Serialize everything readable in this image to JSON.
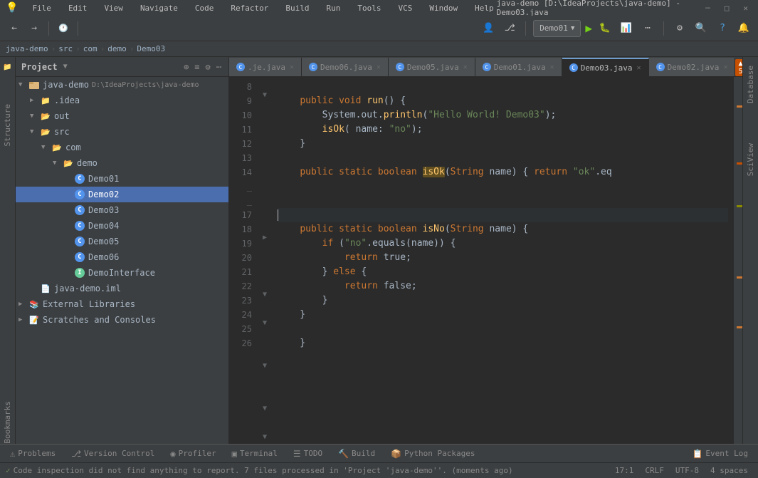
{
  "titlebar": {
    "menu_items": [
      "File",
      "Edit",
      "View",
      "Navigate",
      "Code",
      "Refactor",
      "Build",
      "Run",
      "Tools",
      "VCS",
      "Window",
      "Help"
    ],
    "title": "java-demo [D:\\IdeaProjects\\java-demo] - Demo03.java",
    "win_buttons": [
      "─",
      "□",
      "✕"
    ]
  },
  "toolbar": {
    "run_config": "Demo01",
    "run_label": "▶",
    "debug_label": "🐛"
  },
  "breadcrumb": {
    "items": [
      "java-demo",
      "src",
      "com",
      "demo",
      "Demo03"
    ]
  },
  "project": {
    "title": "Project",
    "root": "java-demo",
    "path": "D:\\IdeaProjects\\java-demo",
    "tree": [
      {
        "label": "java-demo",
        "type": "root",
        "indent": 4,
        "expanded": true,
        "arrow": "▼"
      },
      {
        "label": ".idea",
        "type": "folder",
        "indent": 20,
        "expanded": false,
        "arrow": "▶"
      },
      {
        "label": "out",
        "type": "folder",
        "indent": 20,
        "expanded": true,
        "arrow": "▼"
      },
      {
        "label": "src",
        "type": "folder",
        "indent": 20,
        "expanded": true,
        "arrow": "▼"
      },
      {
        "label": "com",
        "type": "folder",
        "indent": 36,
        "expanded": true,
        "arrow": "▼"
      },
      {
        "label": "demo",
        "type": "folder",
        "indent": 52,
        "expanded": true,
        "arrow": "▼"
      },
      {
        "label": "Demo01",
        "type": "java",
        "indent": 68
      },
      {
        "label": "Demo02",
        "type": "java",
        "indent": 68,
        "selected": true
      },
      {
        "label": "Demo03",
        "type": "java",
        "indent": 68
      },
      {
        "label": "Demo04",
        "type": "java",
        "indent": 68
      },
      {
        "label": "Demo05",
        "type": "java",
        "indent": 68
      },
      {
        "label": "Demo06",
        "type": "java",
        "indent": 68
      },
      {
        "label": "DemoInterface",
        "type": "java-int",
        "indent": 68
      },
      {
        "label": "java-demo.iml",
        "type": "module",
        "indent": 20
      },
      {
        "label": "External Libraries",
        "type": "library",
        "indent": 4,
        "arrow": "▶"
      },
      {
        "label": "Scratches and Consoles",
        "type": "library",
        "indent": 4,
        "arrow": "▶"
      }
    ]
  },
  "tabs": [
    {
      "label": ".je.java",
      "type": "java",
      "active": false
    },
    {
      "label": "Demo06.java",
      "type": "java",
      "active": false
    },
    {
      "label": "Demo05.java",
      "type": "java",
      "active": false
    },
    {
      "label": "Demo01.java",
      "type": "java",
      "active": false
    },
    {
      "label": "Demo03.java",
      "type": "java",
      "active": true
    },
    {
      "label": "Demo02.java",
      "type": "java",
      "active": false
    }
  ],
  "editor": {
    "lines": [
      {
        "num": 8,
        "content": ""
      },
      {
        "num": 9,
        "content": "    public void run() {",
        "tokens": [
          {
            "text": "    ",
            "cls": ""
          },
          {
            "text": "public",
            "cls": "kw"
          },
          {
            "text": " ",
            "cls": ""
          },
          {
            "text": "void",
            "cls": "kw"
          },
          {
            "text": " ",
            "cls": ""
          },
          {
            "text": "run",
            "cls": "fn"
          },
          {
            "text": "() {",
            "cls": ""
          }
        ]
      },
      {
        "num": 10,
        "content": "        System.out.println(\"Hello World! Demo03\");",
        "tokens": [
          {
            "text": "        System.out.",
            "cls": ""
          },
          {
            "text": "println",
            "cls": "fn"
          },
          {
            "text": "(",
            "cls": ""
          },
          {
            "text": "\"Hello World! Demo03\"",
            "cls": "str"
          },
          {
            "text": ");",
            "cls": ""
          }
        ]
      },
      {
        "num": 11,
        "content": "        isOk( name: \"no\");",
        "tokens": [
          {
            "text": "        ",
            "cls": ""
          },
          {
            "text": "isOk",
            "cls": "fn"
          },
          {
            "text": "( ",
            "cls": ""
          },
          {
            "text": "name",
            "cls": "param"
          },
          {
            "text": ": ",
            "cls": ""
          },
          {
            "text": "\"no\"",
            "cls": "str"
          },
          {
            "text": ");",
            "cls": ""
          }
        ]
      },
      {
        "num": 12,
        "content": "    }",
        "tokens": [
          {
            "text": "    }",
            "cls": ""
          }
        ]
      },
      {
        "num": 13,
        "content": ""
      },
      {
        "num": 14,
        "content": "    public static boolean isOk(String name) { return \"ok\".eq",
        "tokens": [
          {
            "text": "    ",
            "cls": ""
          },
          {
            "text": "public",
            "cls": "kw"
          },
          {
            "text": " ",
            "cls": ""
          },
          {
            "text": "static",
            "cls": "kw"
          },
          {
            "text": " ",
            "cls": ""
          },
          {
            "text": "boolean",
            "cls": "kw"
          },
          {
            "text": " ",
            "cls": ""
          },
          {
            "text": "isOk",
            "cls": "fn highlight-isok"
          },
          {
            "text": "(",
            "cls": ""
          },
          {
            "text": "String",
            "cls": "type"
          },
          {
            "text": " ",
            "cls": ""
          },
          {
            "text": "name",
            "cls": "param"
          },
          {
            "text": ") { ",
            "cls": ""
          },
          {
            "text": "return",
            "cls": "kw"
          },
          {
            "text": " ",
            "cls": ""
          },
          {
            "text": "\"ok\"",
            "cls": "str"
          },
          {
            "text": ".eq",
            "cls": ""
          }
        ]
      },
      {
        "num": 17,
        "content": "",
        "cursor": true
      },
      {
        "num": 18,
        "content": "    public static boolean isNo(String name) {",
        "tokens": [
          {
            "text": "    ",
            "cls": ""
          },
          {
            "text": "public",
            "cls": "kw"
          },
          {
            "text": " ",
            "cls": ""
          },
          {
            "text": "static",
            "cls": "kw"
          },
          {
            "text": " ",
            "cls": ""
          },
          {
            "text": "boolean",
            "cls": "kw"
          },
          {
            "text": " ",
            "cls": ""
          },
          {
            "text": "isNo",
            "cls": "fn"
          },
          {
            "text": "(",
            "cls": ""
          },
          {
            "text": "String",
            "cls": "type"
          },
          {
            "text": " ",
            "cls": ""
          },
          {
            "text": "name",
            "cls": "param"
          },
          {
            "text": ") {",
            "cls": ""
          }
        ]
      },
      {
        "num": 19,
        "content": "        if (\"no\".equals(name)) {",
        "tokens": [
          {
            "text": "        ",
            "cls": ""
          },
          {
            "text": "if",
            "cls": "kw"
          },
          {
            "text": " (",
            "cls": ""
          },
          {
            "text": "\"no\"",
            "cls": "str"
          },
          {
            "text": ".equals(name)) {",
            "cls": ""
          }
        ]
      },
      {
        "num": 20,
        "content": "            return true;",
        "tokens": [
          {
            "text": "            ",
            "cls": ""
          },
          {
            "text": "return",
            "cls": "kw"
          },
          {
            "text": " true;",
            "cls": ""
          }
        ]
      },
      {
        "num": 21,
        "content": "        } else {",
        "tokens": [
          {
            "text": "        } ",
            "cls": ""
          },
          {
            "text": "else",
            "cls": "kw"
          },
          {
            "text": " {",
            "cls": ""
          }
        ]
      },
      {
        "num": 22,
        "content": "            return false;",
        "tokens": [
          {
            "text": "            ",
            "cls": ""
          },
          {
            "text": "return",
            "cls": "kw"
          },
          {
            "text": " false;",
            "cls": ""
          }
        ]
      },
      {
        "num": 23,
        "content": "        }",
        "tokens": [
          {
            "text": "        }",
            "cls": ""
          }
        ]
      },
      {
        "num": 24,
        "content": "    }",
        "tokens": [
          {
            "text": "    }",
            "cls": ""
          }
        ]
      },
      {
        "num": 25,
        "content": ""
      },
      {
        "num": 26,
        "content": "    }",
        "tokens": [
          {
            "text": "    }",
            "cls": ""
          }
        ]
      }
    ],
    "cursor_pos": "17:1",
    "line_ending": "CRLF",
    "encoding": "UTF-8",
    "indent": "4 spaces"
  },
  "warnings": {
    "count": "▲ 5"
  },
  "bottom_tabs": [
    {
      "label": "Problems",
      "icon": "⚠",
      "active": false
    },
    {
      "label": "Version Control",
      "icon": "⎇",
      "active": false
    },
    {
      "label": "Profiler",
      "icon": "◉",
      "active": false
    },
    {
      "label": "Terminal",
      "icon": "▣",
      "active": false
    },
    {
      "label": "TODO",
      "icon": "☰",
      "active": false
    },
    {
      "label": "Build",
      "icon": "🔨",
      "active": false
    },
    {
      "label": "Python Packages",
      "icon": "📦",
      "active": false
    },
    {
      "label": "Event Log",
      "icon": "📋",
      "active": false
    }
  ],
  "status": {
    "message": "Code inspection did not find anything to report. 7 files processed in 'Project 'java-demo''. (moments ago)",
    "cursor": "17:1",
    "line_ending": "CRLF",
    "encoding": "UTF-8",
    "indent": "4 spaces"
  },
  "right_panels": [
    "Database",
    "SciView"
  ],
  "left_panels": [
    "Structure",
    "Bookmarks"
  ]
}
